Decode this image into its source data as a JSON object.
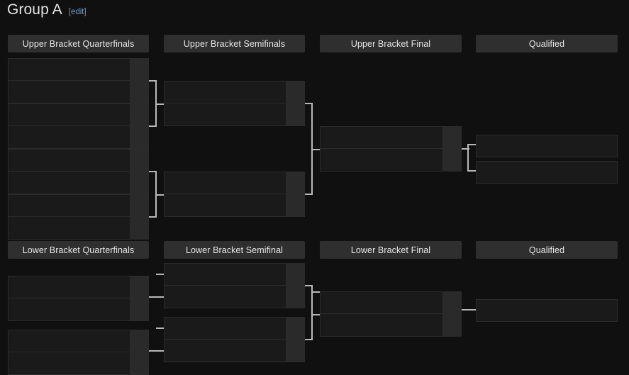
{
  "page": {
    "title": "Group A",
    "edit_label": "[edit]",
    "edit_text": "edit",
    "bracket_left": "[",
    "bracket_right": "]",
    "background_color": "#101010",
    "accent_link_color": "#6f9ed6",
    "line_color": "#b9b9b9",
    "row_color": "#1a1a1a",
    "score_color": "#2a2a2a",
    "header_pill_color": "#2f2f2f"
  },
  "upper_bracket": {
    "headers": [
      {
        "label": "Upper Bracket Quarterfinals"
      },
      {
        "label": "Upper Bracket Semifinals"
      },
      {
        "label": "Upper Bracket Final"
      },
      {
        "label": "Qualified"
      }
    ],
    "quarterfinals": [
      {
        "team1": "",
        "score1": "",
        "team2": "",
        "score2": ""
      },
      {
        "team1": "",
        "score1": "",
        "team2": "",
        "score2": ""
      },
      {
        "team1": "",
        "score1": "",
        "team2": "",
        "score2": ""
      },
      {
        "team1": "",
        "score1": "",
        "team2": "",
        "score2": ""
      }
    ],
    "semifinals": [
      {
        "team1": "",
        "score1": "",
        "team2": "",
        "score2": ""
      },
      {
        "team1": "",
        "score1": "",
        "team2": "",
        "score2": ""
      }
    ],
    "final": [
      {
        "team1": "",
        "score1": "",
        "team2": "",
        "score2": ""
      }
    ],
    "qualified": [
      {
        "team": ""
      },
      {
        "team": ""
      }
    ]
  },
  "lower_bracket": {
    "headers": [
      {
        "label": "Lower Bracket Quarterfinals"
      },
      {
        "label": "Lower Bracket Semifinal"
      },
      {
        "label": "Lower Bracket Final"
      },
      {
        "label": "Qualified"
      }
    ],
    "quarterfinals": [
      {
        "team1": "",
        "score1": "",
        "team2": "",
        "score2": ""
      },
      {
        "team1": "",
        "score1": "",
        "team2": "",
        "score2": ""
      }
    ],
    "semifinals": [
      {
        "team1": "",
        "score1": "",
        "team2": "",
        "score2": ""
      },
      {
        "team1": "",
        "score1": "",
        "team2": "",
        "score2": ""
      }
    ],
    "final": [
      {
        "team1": "",
        "score1": "",
        "team2": "",
        "score2": ""
      }
    ],
    "qualified": [
      {
        "team": ""
      }
    ]
  }
}
